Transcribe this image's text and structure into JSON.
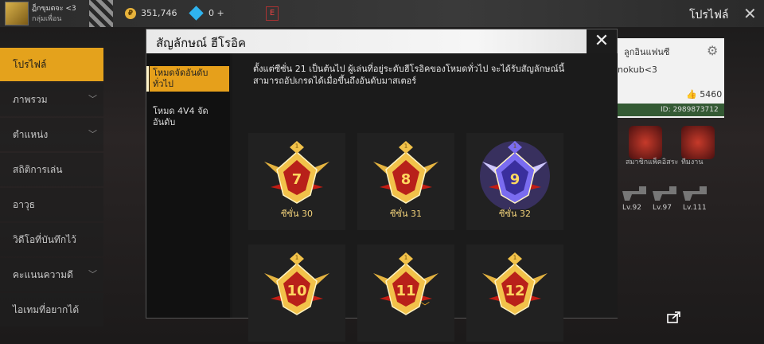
{
  "topbar": {
    "player_name": "ฏ็กขุมตจะ <3",
    "player_sub": "กลุ่มเพื่อน",
    "coins": "351,746",
    "gems": "0 +",
    "page_title": "โปรไฟล์",
    "coin_glyph": "₽"
  },
  "sidenav": {
    "items": [
      {
        "label": "โปรไฟล์",
        "active": true
      },
      {
        "label": "ภาพรวม",
        "chevron": true
      },
      {
        "label": "ตำแหน่ง",
        "chevron": true
      },
      {
        "label": "สถิติการเล่น"
      },
      {
        "label": "อาวุธ"
      },
      {
        "label": "วิดีโอที่บันทึกไว้"
      },
      {
        "label": "คะแนนความดี",
        "chevron": true
      },
      {
        "label": "ไอเทมที่อยากได้"
      }
    ]
  },
  "profile": {
    "guild": "ลูกอินแฟนซี",
    "name": "nokub<3",
    "likes": "5460",
    "id": "ID: 2989873712",
    "badges": [
      "สมาชิกแพ็คอิสระ",
      "ทีมงาน"
    ],
    "levels": [
      "Lv.92",
      "Lv.97",
      "Lv.111"
    ]
  },
  "modal": {
    "title": "สัญลักษณ์ ฮีโรอิค",
    "tabs": [
      {
        "label": "โหมดจัดอันดับทั่วไป",
        "active": true
      },
      {
        "label": "โหมด 4V4 จัดอันดับ",
        "active": false
      }
    ],
    "description": "ตั้งแต่ซีซั่น 21 เป็นต้นไป ผู้เล่นที่อยู่ระดับฮีโรอิคของโหมดทั่วไป จะได้รับสัญลักษณ์นี้ สามารถอัปเกรดได้เมื่อขึ้นถึงอันดับมาสเตอร์",
    "emblems": [
      {
        "number": "7",
        "label": "ซีซั่น 30",
        "style": "gold"
      },
      {
        "number": "8",
        "label": "ซีซั่น 31",
        "style": "gold"
      },
      {
        "number": "9",
        "label": "ซีซั่น 32",
        "style": "purple"
      },
      {
        "number": "10",
        "label": "",
        "style": "gold"
      },
      {
        "number": "11",
        "label": "",
        "style": "gold"
      },
      {
        "number": "12",
        "label": "",
        "style": "gold"
      }
    ]
  },
  "colors": {
    "accent": "#e6a01b",
    "gold": "#f2c24a",
    "red": "#b8201a",
    "purple": "#6b4bd8"
  }
}
